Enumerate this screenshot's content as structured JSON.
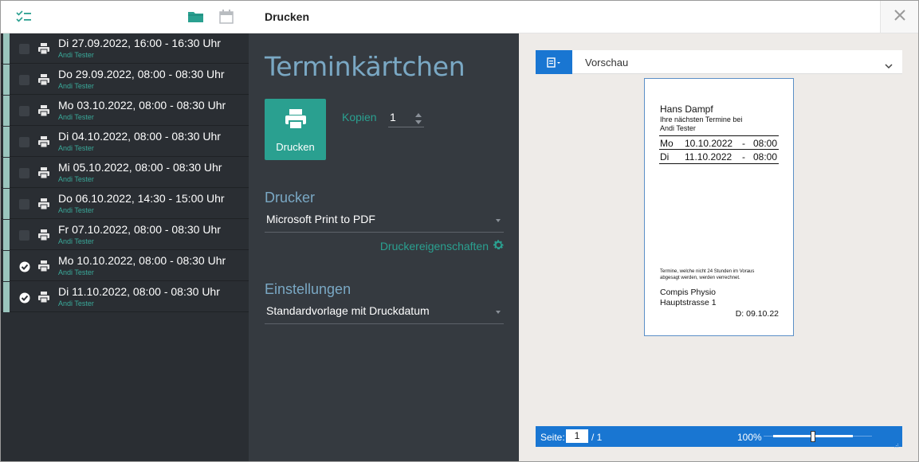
{
  "header": {
    "title": "Drucken"
  },
  "appointments": [
    {
      "title": "Di 27.09.2022, 16:00 - 16:30 Uhr",
      "person": "Andi Tester",
      "checked": false
    },
    {
      "title": "Do 29.09.2022, 08:00 - 08:30 Uhr",
      "person": "Andi Tester",
      "checked": false
    },
    {
      "title": "Mo 03.10.2022, 08:00 - 08:30 Uhr",
      "person": "Andi Tester",
      "checked": false
    },
    {
      "title": "Di 04.10.2022, 08:00 - 08:30 Uhr",
      "person": "Andi Tester",
      "checked": false
    },
    {
      "title": "Mi 05.10.2022, 08:00 - 08:30 Uhr",
      "person": "Andi Tester",
      "checked": false
    },
    {
      "title": "Do 06.10.2022, 14:30 - 15:00 Uhr",
      "person": "Andi Tester",
      "checked": false
    },
    {
      "title": "Fr 07.10.2022, 08:00 - 08:30 Uhr",
      "person": "Andi Tester",
      "checked": false
    },
    {
      "title": "Mo 10.10.2022, 08:00 - 08:30 Uhr",
      "person": "Andi Tester",
      "checked": true
    },
    {
      "title": "Di 11.10.2022, 08:00 - 08:30 Uhr",
      "person": "Andi Tester",
      "checked": true
    }
  ],
  "middle": {
    "title": "Terminkärtchen",
    "print_button": "Drucken",
    "copies_label": "Kopien",
    "copies_value": "1",
    "printer_label": "Drucker",
    "printer_value": "Microsoft Print to PDF",
    "printer_properties": "Druckereigenschaften",
    "settings_label": "Einstellungen",
    "settings_value": "Standardvorlage mit Druckdatum"
  },
  "preview": {
    "title": "Vorschau",
    "card": {
      "name": "Hans Dampf",
      "line1": "Ihre nächsten Termine bei",
      "line2": "Andi Tester",
      "rows": [
        {
          "day": "Mo",
          "date": "10.10.2022",
          "sep": "-",
          "time": "08:00"
        },
        {
          "day": "Di",
          "date": "11.10.2022",
          "sep": "-",
          "time": "08:00"
        }
      ],
      "note1": "Termine, welche nicht 24 Stunden im Voraus",
      "note2": "abgesagt werden, werden verrechnet.",
      "company": "Compis Physio",
      "address": "Hauptstrasse 1",
      "print_date": "D: 09.10.22"
    },
    "footer": {
      "page_label": "Seite:",
      "page_value": "1",
      "page_total": "/ 1",
      "zoom": "100%",
      "zoom_fraction": 0.5
    }
  },
  "colors": {
    "accent": "#2aa090",
    "heading": "#7aa8c4",
    "preview_blue": "#1976d2"
  }
}
